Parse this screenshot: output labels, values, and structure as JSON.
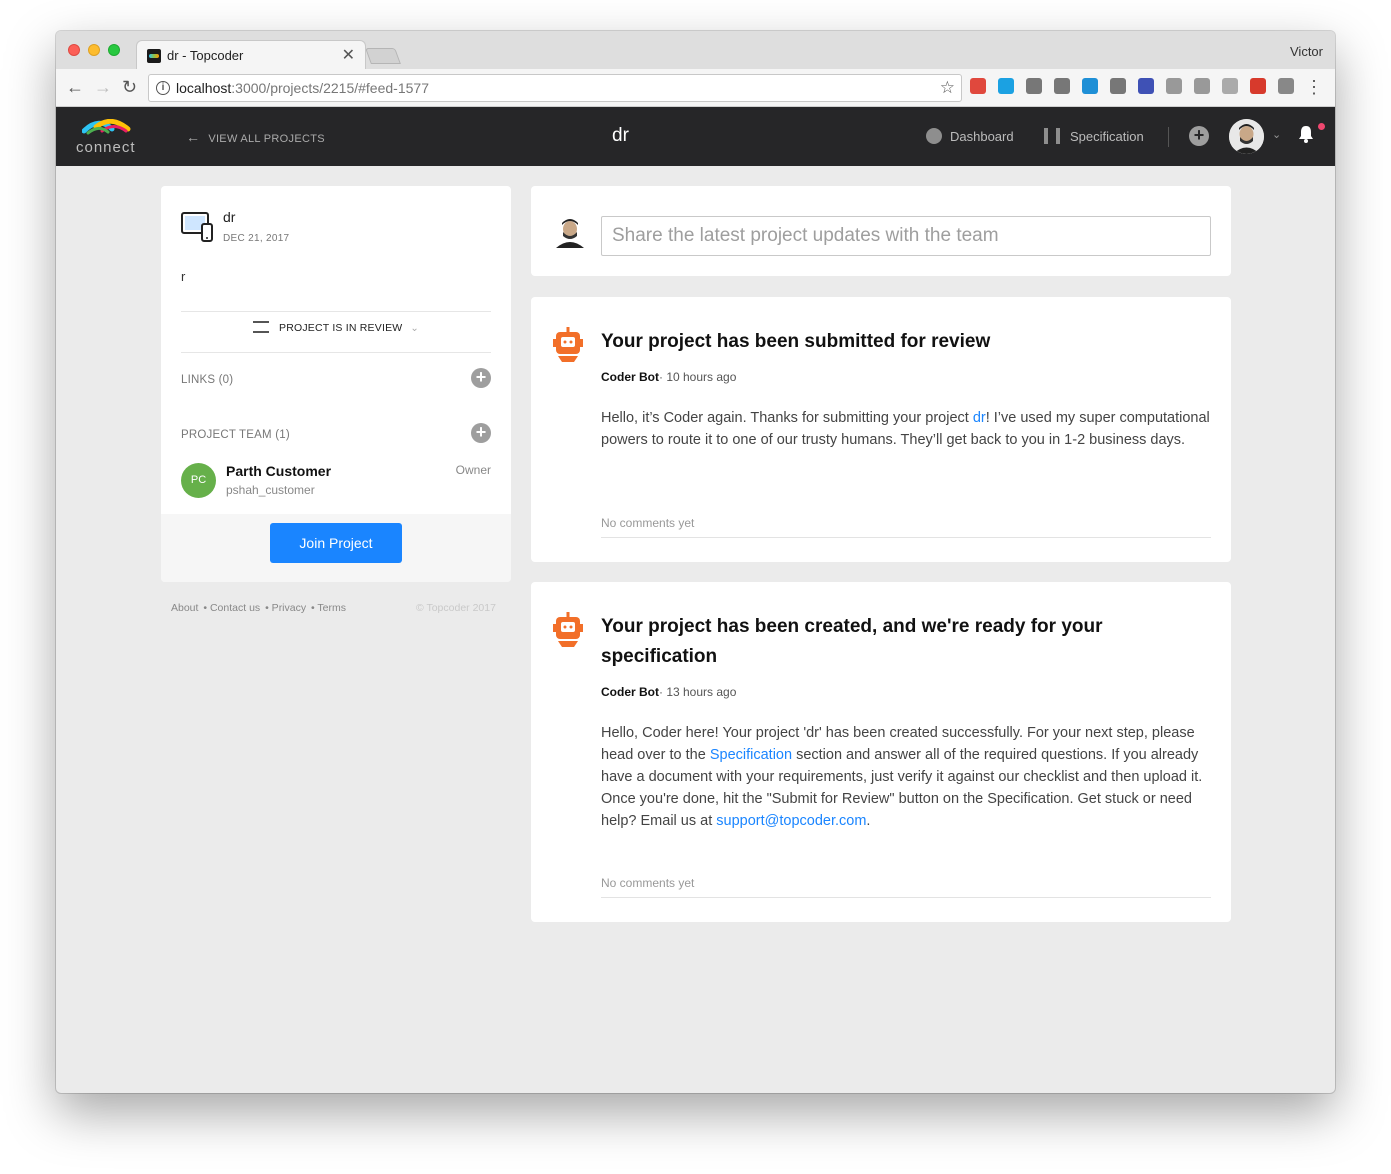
{
  "browser": {
    "tab_title": "dr - Topcoder",
    "tab_close": "✕",
    "user": "Victor",
    "url_host": "localhost",
    "url_path": ":3000/projects/2215/#feed-1577",
    "info_glyph": "i",
    "star_glyph": "☆",
    "back_glyph": "←",
    "forward_glyph": "→",
    "reload_glyph": "↻",
    "menu_glyph": "⋮",
    "extension_colors": [
      "#e0483d",
      "#1ba1e2",
      "#777777",
      "#777777",
      "#1e8fd6",
      "#777777",
      "#3f51b5",
      "#999999",
      "#999999",
      "#aaaaaa",
      "#d73a2c",
      "#888888"
    ]
  },
  "header": {
    "logo_text": "connect",
    "back_label": "VIEW ALL PROJECTS",
    "back_glyph": "←",
    "title": "dr",
    "nav": [
      {
        "label": "Dashboard",
        "icon": "dashboard-icon"
      },
      {
        "label": "Specification",
        "icon": "specification-icon"
      }
    ],
    "plus_glyph": "+",
    "chevron_glyph": "⌄",
    "notification_color": "#ef476f"
  },
  "sidebar": {
    "project_name": "dr",
    "project_date": "DEC 21, 2017",
    "project_description": "r",
    "status_label": "PROJECT IS IN REVIEW",
    "status_chevron": "⌄",
    "links_label": "LINKS (0)",
    "team_label": "PROJECT TEAM (1)",
    "add_glyph": "+",
    "members": [
      {
        "initials": "PC",
        "name": "Parth Customer",
        "handle": "pshah_customer",
        "role": "Owner"
      }
    ],
    "join_label": "Join Project"
  },
  "footer": {
    "links": [
      "About",
      "• Contact us",
      "• Privacy",
      "• Terms"
    ],
    "copyright": "© Topcoder 2017"
  },
  "composer": {
    "placeholder": "Share the latest project updates with the team"
  },
  "posts": [
    {
      "title": "Your project has been submitted for review",
      "author": "Coder Bot",
      "time": "· 10 hours ago",
      "body_1": "Hello, it’s Coder again. Thanks for submitting your project ",
      "link_1": "dr",
      "body_2": "! I’ve used my super computational powers to route it to one of our trusty humans. They’ll get back to you in 1-2 business days.",
      "comments": "No comments yet"
    },
    {
      "title": "Your project has been created, and we're ready for your specification",
      "author": "Coder Bot",
      "time": "· 13 hours ago",
      "body_1": "Hello, Coder here! Your project 'dr' has been created successfully. For your next step, please head over to the ",
      "link_1": "Specification",
      "body_2": " section and answer all of the required questions. If you already have a document with your requirements, just verify it against our checklist and then upload it. Once you're done, hit the \"Submit for Review\" button on the Specification. Get stuck or need help? Email us at ",
      "link_2": "support@topcoder.com",
      "body_3": ".",
      "comments": "No comments yet"
    }
  ],
  "colors": {
    "accent": "#1a85ff",
    "header_bg": "#262628",
    "member_avatar": "#66b04a",
    "bot_orange": "#f26f29"
  }
}
